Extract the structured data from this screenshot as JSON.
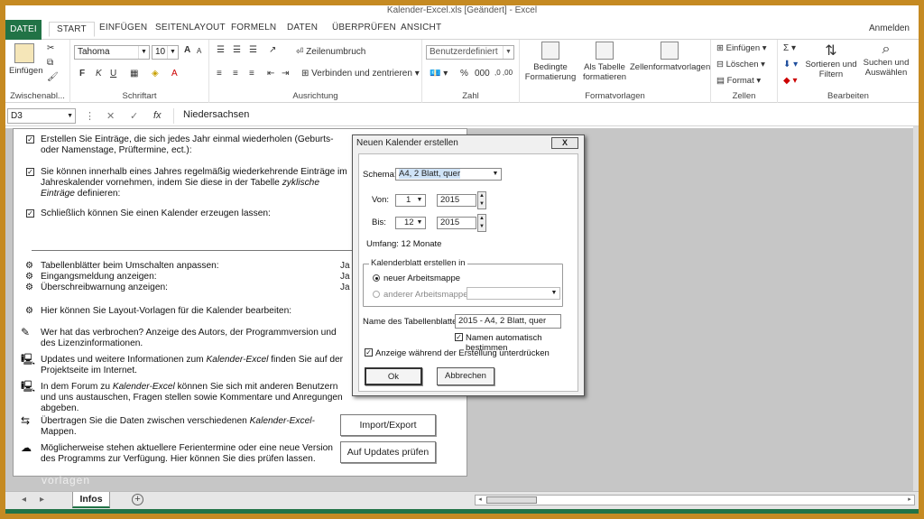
{
  "window": {
    "title": "Kalender-Excel.xls [Geändert] - Excel"
  },
  "ribbon_tabs": [
    "DATEI",
    "START",
    "EINFÜGEN",
    "SEITENLAYOUT",
    "FORMELN",
    "DATEN",
    "ÜBERPRÜFEN",
    "ANSICHT"
  ],
  "signin": "Anmelden",
  "clipboard": {
    "paste": "Einfügen",
    "label": "Zwischenabl..."
  },
  "font": {
    "name": "Tahoma",
    "size": "10",
    "bold": "F",
    "italic": "K",
    "underline": "U",
    "grow": "A",
    "shrink": "A",
    "label": "Schriftart"
  },
  "alignment": {
    "wrap": "Zeilenumbruch",
    "merge": "Verbinden und zentrieren",
    "label": "Ausrichtung"
  },
  "number": {
    "format": "Benutzerdefiniert",
    "label": "Zahl"
  },
  "styles": {
    "conditional": "Bedingte Formatierung",
    "astable": "Als Tabelle formatieren",
    "cellstyles": "Zellenformatvorlagen",
    "label": "Formatvorlagen"
  },
  "cells": {
    "insert": "Einfügen",
    "delete": "Löschen",
    "format": "Format",
    "label": "Zellen"
  },
  "editing": {
    "sort": "Sortieren und Filtern",
    "find": "Suchen und Auswählen",
    "label": "Bearbeiten"
  },
  "formula_bar": {
    "namebox": "D3",
    "fx": "fx",
    "value": "Niedersachsen"
  },
  "sheet": {
    "rows": [
      {
        "text": "Erstellen Sie Einträge, die sich jedes Jahr einmal wiederholen (Geburts- oder Namenstage, Prüftermine, ect.):"
      },
      {
        "text_a": "Sie können innerhalb eines Jahres regelmäßig wiederkehrende Einträge im Jahreskalender vornehmen, indem Sie diese in der Tabelle ",
        "text_i": "zyklische Einträge",
        "text_b": " definieren:"
      },
      {
        "text": "Schließlich können Sie einen Kalender erzeugen lassen:"
      },
      {
        "text": "Tabellenblätter beim Umschalten anpassen:"
      },
      {
        "text": "Eingangsmeldung anzeigen:"
      },
      {
        "text": "Überschreibwarnung anzeigen:"
      },
      {
        "text": "Hier können Sie Layout-Vorlagen für die Kalender bearbeiten:"
      },
      {
        "text": "Wer hat das verbrochen? Anzeige des Autors, der Programmversion und des Lizenzinformationen."
      },
      {
        "text_a": "Updates und weitere Informationen zum ",
        "text_i": "Kalender-Excel",
        "text_b": " finden Sie auf der Projektseite im Internet."
      },
      {
        "text_a": "In dem Forum zu ",
        "text_i": "Kalender-Excel",
        "text_b": " können Sie sich mit anderen Benutzern und uns austauschen, Fragen stellen sowie Kommentare und Anregungen abgeben."
      },
      {
        "text_a": "Übertragen Sie die Daten zwischen verschiedenen ",
        "text_i": "Kalender-Excel-",
        "text_b": "Mappen."
      },
      {
        "text": "Möglicherweise stehen aktuellere Ferientermine oder eine neue Version des Programms zur Verfügung. Hier können Sie dies prüfen lassen."
      }
    ],
    "ja": [
      "Ja",
      "Ja",
      "Ja"
    ],
    "btn_import": "Import/Export",
    "btn_updates": "Auf Updates prüfen",
    "watermark": "vorlagen"
  },
  "dialog": {
    "title": "Neuen Kalender erstellen",
    "close": "X",
    "schema_label": "Schema:",
    "schema_value": "A4, 2 Blatt, quer",
    "von_label": "Von:",
    "von_month": "1",
    "von_year": "2015",
    "bis_label": "Bis:",
    "bis_month": "12",
    "bis_year": "2015",
    "umfang": "Umfang: 12 Monate",
    "group_label": "Kalenderblatt erstellen in",
    "radio_new": "neuer Arbeitsmappe",
    "radio_other": "anderer Arbeitsmappe:",
    "name_label": "Name des Tabellenblattes:",
    "name_value": "2015 - A4, 2 Blatt, quer",
    "auto_name": "Namen automatisch bestimmen",
    "show_progress": "Anzeige während der Erstellung unterdrücken",
    "ok": "Ok",
    "cancel": "Abbrechen"
  },
  "sheet_tabs": {
    "active": "Infos",
    "add": "+"
  }
}
